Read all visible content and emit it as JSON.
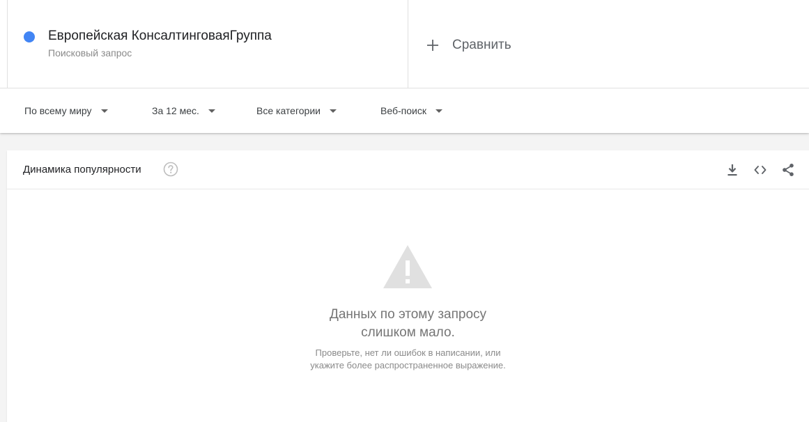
{
  "colors": {
    "term_dot": "#4285f4",
    "icon_gray": "#5f6368",
    "warning_gray": "#e0e0e0"
  },
  "terms": [
    {
      "title": "Европейская КонсалтинговаяГруппа",
      "subtitle": "Поисковый запрос"
    }
  ],
  "compare": {
    "icon": "plus-icon",
    "label": "Сравнить"
  },
  "filters": {
    "region": "По всему миру",
    "period": "За 12 мес.",
    "category": "Все категории",
    "search_type": "Веб-поиск"
  },
  "panel": {
    "title": "Динамика популярности",
    "icons": [
      "help-icon",
      "download-icon",
      "embed-icon",
      "share-icon"
    ]
  },
  "empty_state": {
    "icon": "warning-icon",
    "title_line1": "Данных по этому запросу",
    "title_line2": "слишком мало.",
    "hint_line1": "Проверьте, нет ли ошибок в написании, или",
    "hint_line2": "укажите более распространенное выражение."
  }
}
